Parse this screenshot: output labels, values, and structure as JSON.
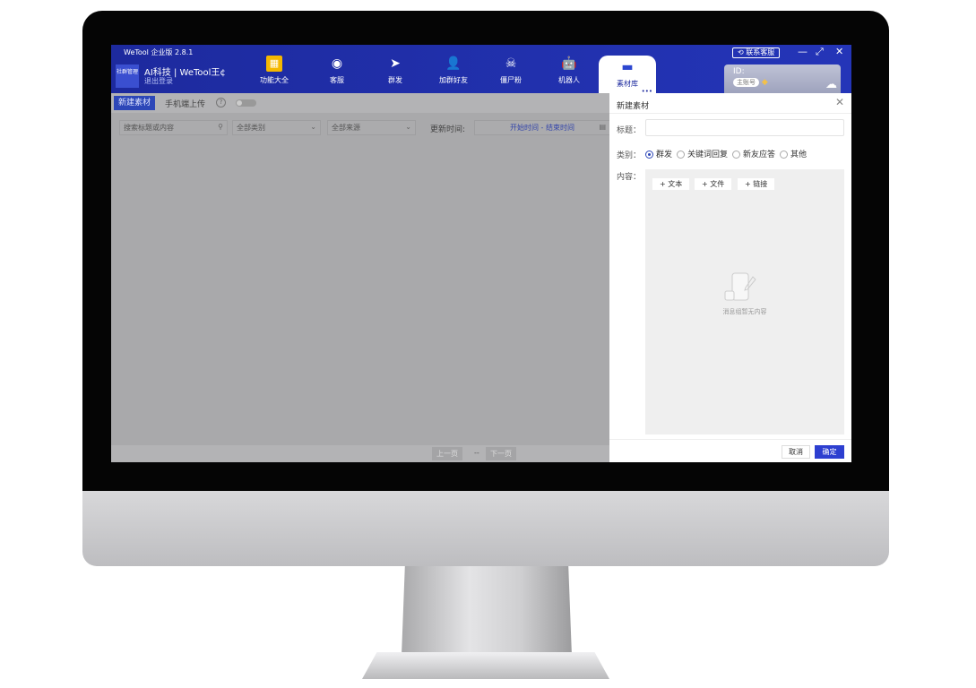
{
  "app": {
    "title": "WeTool 企业版 2.8.1",
    "logo_text": "社群管理",
    "org_name": "AI科技 | WeTool王¢",
    "logout": "退出登录",
    "contact": "联系客服",
    "minimize": "—",
    "maximize": "⤢",
    "close": "✕"
  },
  "nav": [
    {
      "label": "功能大全",
      "icon": "grid-icon"
    },
    {
      "label": "客服",
      "icon": "headset-icon"
    },
    {
      "label": "群发",
      "icon": "send-icon"
    },
    {
      "label": "加群好友",
      "icon": "add-user-icon"
    },
    {
      "label": "僵尸粉",
      "icon": "skull-icon"
    },
    {
      "label": "机器人",
      "icon": "robot-icon"
    },
    {
      "label": "素材库",
      "icon": "folder-icon",
      "active": true
    }
  ],
  "more": "•••",
  "account": {
    "id_label": "ID:",
    "badge": "主账号"
  },
  "toolbar": {
    "new_button": "新建素材",
    "mobile_upload": "手机端上传",
    "help": "?",
    "toggle_on": false
  },
  "filters": {
    "search_placeholder": "搜索标题或内容",
    "category": "全部类别",
    "source": "全部来源",
    "update_time_label": "更新时间:",
    "date_range": "开始时间 - 结束时间"
  },
  "pagination": {
    "prev": "上一页",
    "sep": "--",
    "next": "下一页"
  },
  "panel": {
    "title": "新建素材",
    "title_label": "标题：",
    "title_value": "",
    "category_label": "类别：",
    "categories": [
      {
        "label": "群发",
        "checked": true
      },
      {
        "label": "关键词回复",
        "checked": false
      },
      {
        "label": "新友应答",
        "checked": false
      },
      {
        "label": "其他",
        "checked": false
      }
    ],
    "content_label": "内容：",
    "add_text": "+ 文本",
    "add_file": "+ 文件",
    "add_link": "+ 链接",
    "empty": "消息组暂无内容",
    "cancel": "取消",
    "confirm": "确定"
  },
  "colors": {
    "header": "#1f2ea8",
    "accent": "#2d3fd0",
    "overlay": "#a9a9ab"
  }
}
